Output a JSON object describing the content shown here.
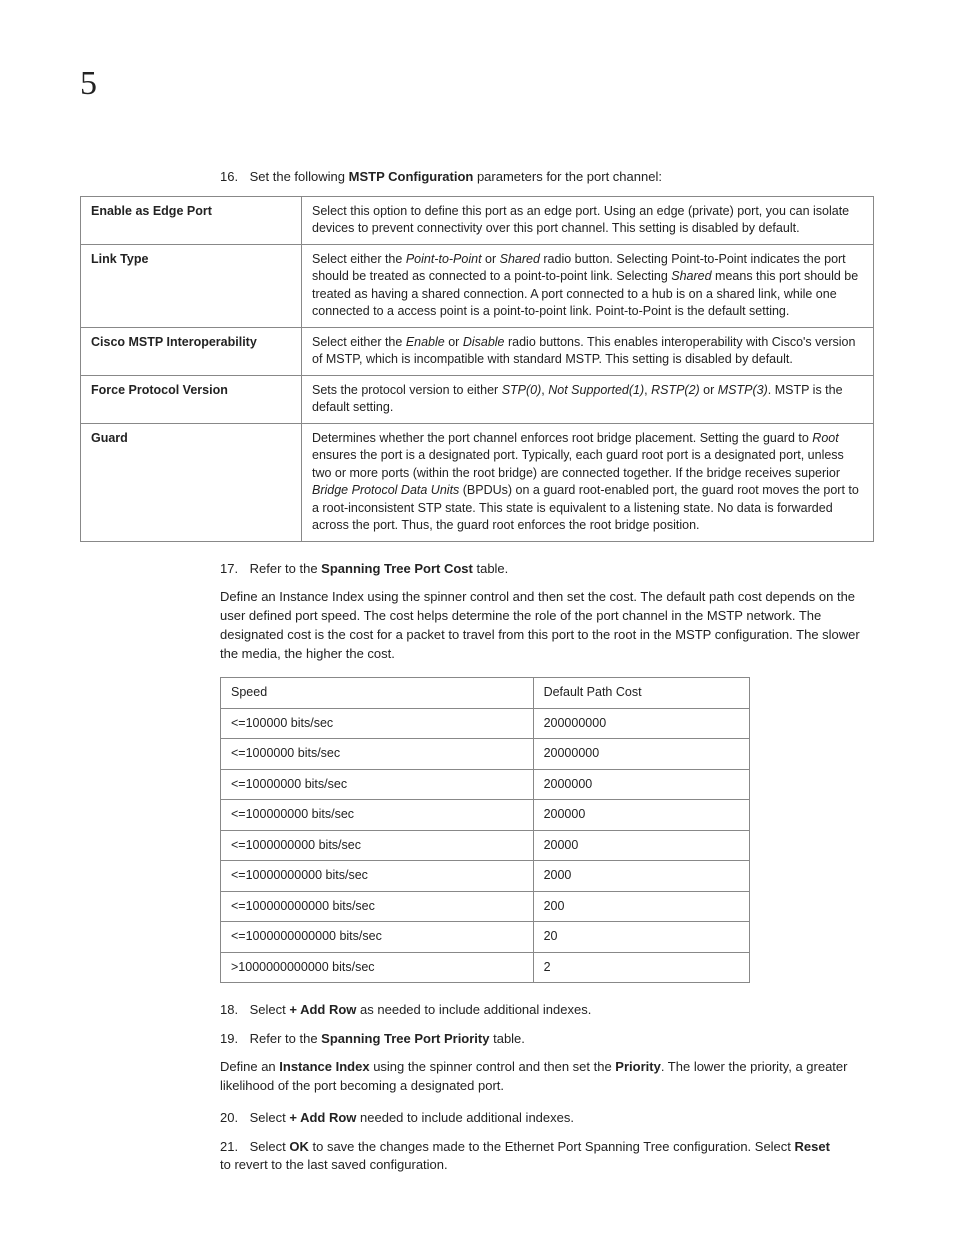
{
  "chapter": "5",
  "step16": {
    "num": "16.",
    "pre": "Set the following ",
    "bold": "MSTP Configuration",
    "post": " parameters for the port channel:"
  },
  "mstp": [
    {
      "label": "Enable as Edge Port",
      "segs": [
        {
          "t": "Select this option to define this port as an edge port. Using an edge (private) port, you can isolate devices to prevent connectivity over this port channel. This setting is disabled by default."
        }
      ]
    },
    {
      "label": "Link Type",
      "segs": [
        {
          "t": "Select either the "
        },
        {
          "t": "Point-to-Point",
          "i": true
        },
        {
          "t": " or "
        },
        {
          "t": "Shared",
          "i": true
        },
        {
          "t": " radio button. Selecting Point-to-Point indicates the port should be treated as connected to a point-to-point link. Selecting "
        },
        {
          "t": "Shared",
          "i": true
        },
        {
          "t": " means this port should be treated as having a shared connection. A port connected to a hub is on a shared link, while one connected to a access point is a point-to-point link. Point-to-Point is the default setting."
        }
      ]
    },
    {
      "label": "Cisco MSTP Interoperability",
      "segs": [
        {
          "t": "Select either the "
        },
        {
          "t": "Enable",
          "i": true
        },
        {
          "t": " or "
        },
        {
          "t": "Disable",
          "i": true
        },
        {
          "t": " radio buttons. This enables interoperability with Cisco's version of MSTP, which is incompatible with standard MSTP. This setting is disabled by default."
        }
      ]
    },
    {
      "label": "Force Protocol Version",
      "segs": [
        {
          "t": "Sets the protocol version to either "
        },
        {
          "t": "STP(0)",
          "i": true
        },
        {
          "t": ", "
        },
        {
          "t": "Not Supported(1)",
          "i": true
        },
        {
          "t": ", "
        },
        {
          "t": "RSTP(2)",
          "i": true
        },
        {
          "t": " or "
        },
        {
          "t": "MSTP(3)",
          "i": true
        },
        {
          "t": ". MSTP is the default setting."
        }
      ]
    },
    {
      "label": "Guard",
      "segs": [
        {
          "t": "Determines whether the port channel enforces root bridge placement. Setting the guard to "
        },
        {
          "t": "Root",
          "i": true
        },
        {
          "t": " ensures the port is a designated port. Typically, each guard root port is a designated port, unless two or more ports (within the root bridge) are connected together. If the bridge receives superior "
        },
        {
          "t": "Bridge Protocol Data Units",
          "i": true
        },
        {
          "t": " (BPDUs) on a guard root-enabled port, the guard root moves the port to a root-inconsistent STP state. This state is equivalent to a listening state. No data is forwarded across the port. Thus, the guard root enforces the root bridge position."
        }
      ]
    }
  ],
  "step17": {
    "num": "17.",
    "pre": "Refer to the ",
    "bold": "Spanning Tree Port Cost",
    "post": " table."
  },
  "para17": "Define an Instance Index using the spinner control and then set the cost. The default path cost depends on the user defined port speed. The cost helps determine the role of the port channel in the MSTP network. The designated cost is the cost for a packet to travel from this port to the root in the MSTP configuration. The slower the media, the higher the cost.",
  "cost": {
    "h1": "Speed",
    "h2": "Default Path Cost",
    "rows": [
      {
        "s": "<=100000 bits/sec",
        "c": "200000000"
      },
      {
        "s": "<=1000000 bits/sec",
        "c": "20000000"
      },
      {
        "s": "<=10000000 bits/sec",
        "c": "2000000"
      },
      {
        "s": "<=100000000 bits/sec",
        "c": "200000"
      },
      {
        "s": "<=1000000000 bits/sec",
        "c": "20000"
      },
      {
        "s": "<=10000000000 bits/sec",
        "c": "2000"
      },
      {
        "s": "<=100000000000 bits/sec",
        "c": "200"
      },
      {
        "s": "<=1000000000000 bits/sec",
        "c": "20"
      },
      {
        "s": ">1000000000000 bits/sec",
        "c": "2"
      }
    ]
  },
  "step18": {
    "num": "18.",
    "pre": "Select ",
    "bold": "+ Add Row",
    "post": " as needed to include additional indexes."
  },
  "step19": {
    "num": "19.",
    "pre": "Refer to the ",
    "bold": "Spanning Tree Port Priority",
    "post": " table."
  },
  "para19": {
    "pre": "Define an ",
    "b1": "Instance Index",
    "mid": " using the spinner control and then set the ",
    "b2": "Priority",
    "post": ". The lower the priority, a greater likelihood of the port becoming a designated port."
  },
  "step20": {
    "num": "20.",
    "pre": "Select ",
    "bold": "+ Add Row",
    "post": " needed to include additional indexes."
  },
  "step21": {
    "num": "21.",
    "pre": "Select ",
    "b1": "OK",
    "mid": " to save the changes made to the Ethernet Port Spanning Tree configuration. Select ",
    "b2": "Reset",
    "post": " to revert to the last saved configuration."
  }
}
